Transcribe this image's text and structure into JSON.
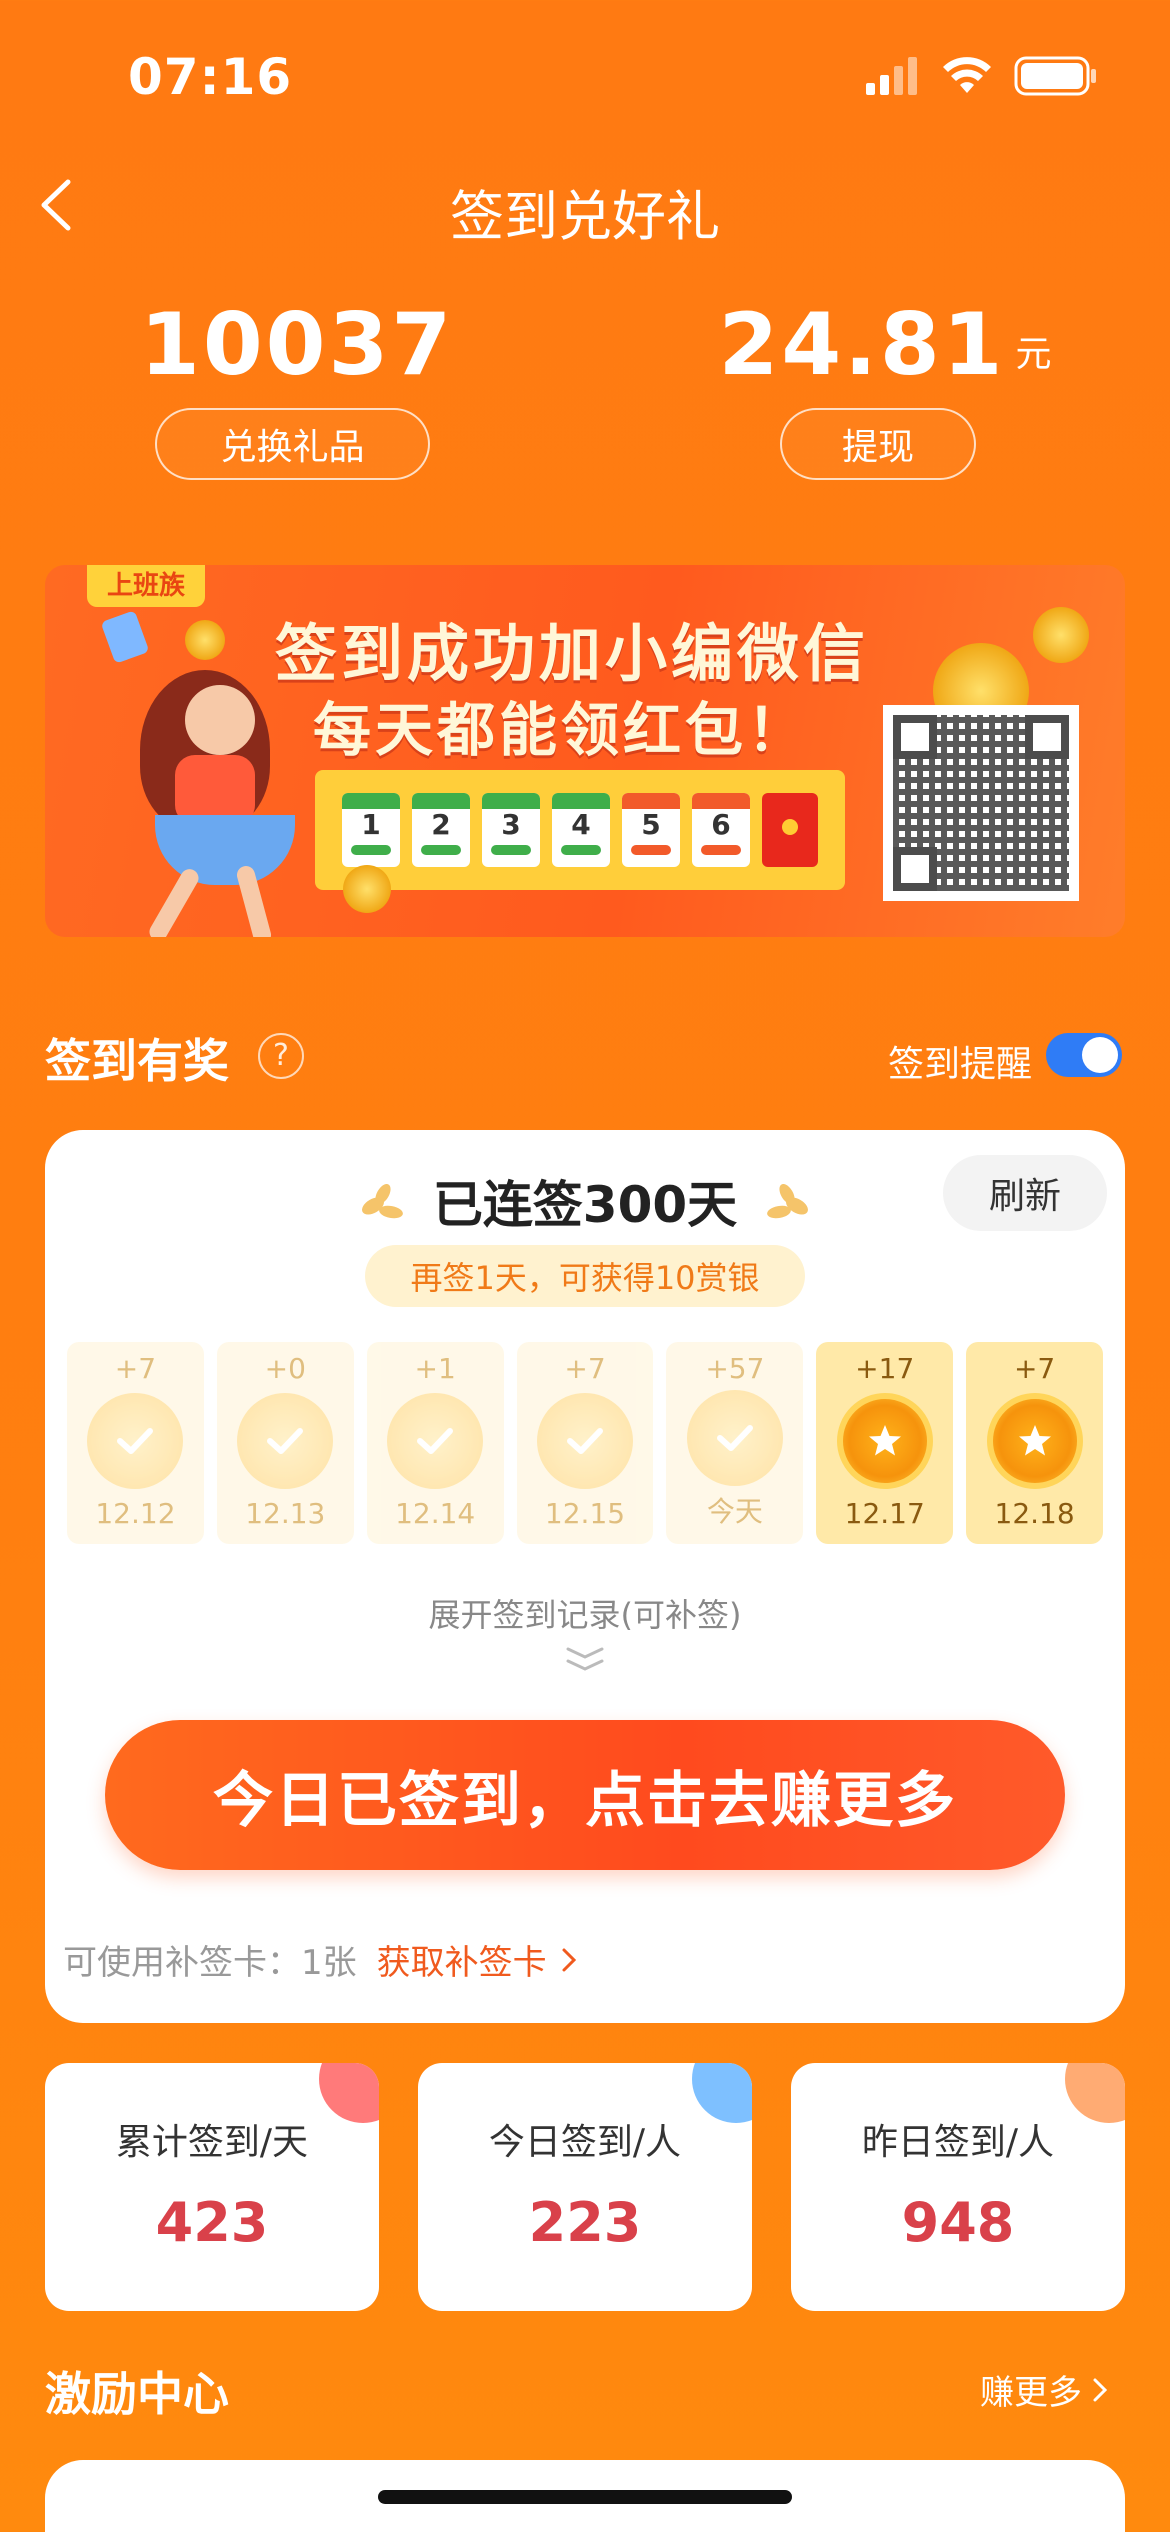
{
  "status": {
    "time": "07:16"
  },
  "nav": {
    "title": "签到兑好礼"
  },
  "balances": {
    "points": "10037",
    "points_button": "兑换礼品",
    "cash": "24.81",
    "cash_unit": "元",
    "cash_button": "提现"
  },
  "banner": {
    "tag": "上班族",
    "line1": "签到成功加小编微信",
    "line2": "每天都能领红包！",
    "calendar_days": [
      "1",
      "2",
      "3",
      "4",
      "5",
      "6"
    ]
  },
  "checkin": {
    "section_title": "签到有奖",
    "help_icon": "?",
    "reminder_label": "签到提醒",
    "reminder_on": true,
    "streak_text": "已连签300天",
    "refresh_label": "刷新",
    "hint": "再签1天，可获得10赏银",
    "days": [
      {
        "pts": "+7",
        "date": "12.12",
        "state": "past"
      },
      {
        "pts": "+0",
        "date": "12.13",
        "state": "past"
      },
      {
        "pts": "+1",
        "date": "12.14",
        "state": "past"
      },
      {
        "pts": "+7",
        "date": "12.15",
        "state": "past"
      },
      {
        "pts": "+57",
        "date": "今天",
        "state": "past"
      },
      {
        "pts": "+17",
        "date": "12.17",
        "state": "future"
      },
      {
        "pts": "+7",
        "date": "12.18",
        "state": "future"
      }
    ],
    "expand_label": "展开签到记录(可补签)",
    "main_button": "今日已签到，点击去赚更多",
    "makeup_label": "可使用补签卡：",
    "makeup_count": "1张",
    "makeup_link": "获取补签卡"
  },
  "stats": [
    {
      "label": "累计签到/天",
      "value": "423",
      "color": "#ff7a7a"
    },
    {
      "label": "今日签到/人",
      "value": "223",
      "color": "#7ec0ff"
    },
    {
      "label": "昨日签到/人",
      "value": "948",
      "color": "#ffab73"
    }
  ],
  "incentive": {
    "title": "激励中心",
    "more": "赚更多"
  }
}
